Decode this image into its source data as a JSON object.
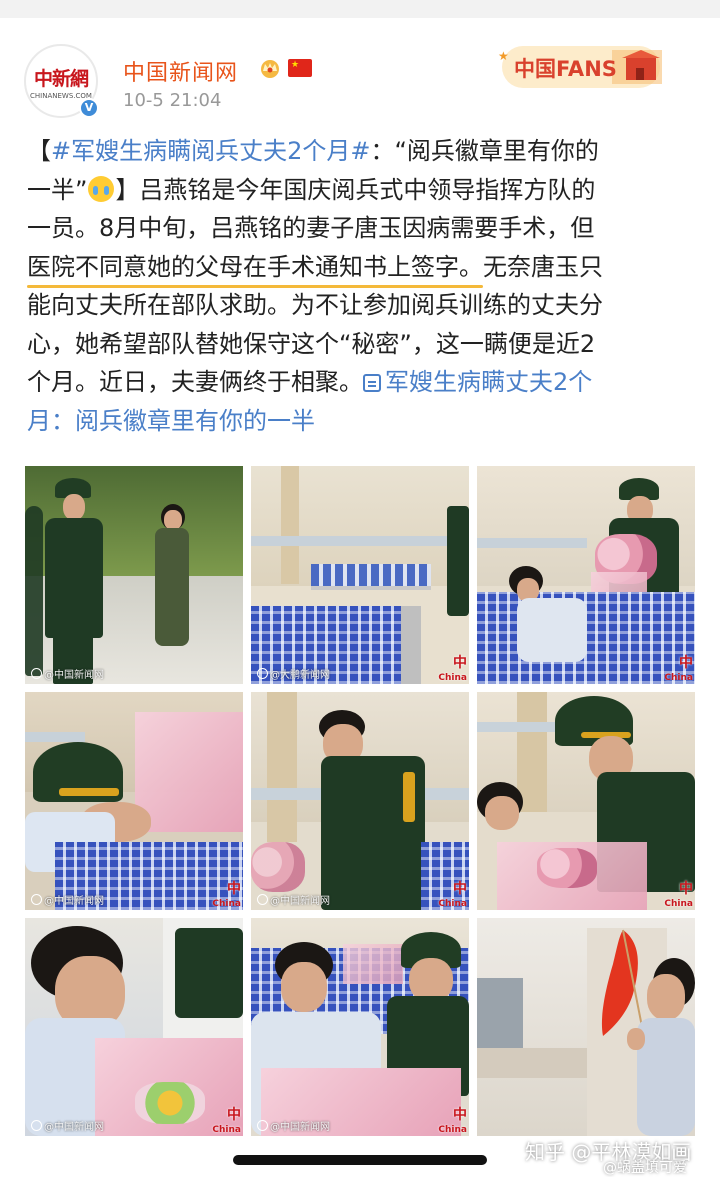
{
  "post": {
    "author": "中国新闻网",
    "avatar_logo": "中新網",
    "avatar_sub": "CHINANEWS.COM",
    "timestamp": "10-5 21:04",
    "fans_badge": "中国FANS",
    "text": {
      "l1_a": "【",
      "l1_topic": "#军嫂生病瞒阅兵丈夫2个月#",
      "l1_b": "：“阅兵徽章里有你的",
      "l2_a": "一半”",
      "l2_b": "】吕燕铭是今年国庆阅兵式中领导指挥方队的",
      "l3": "一员。8月中旬，吕燕铭的妻子唐玉因病需要手术，但",
      "l4_marked": "医院不同意她的父母在手术通知书上签字。",
      "l4_b": "无奈唐玉只",
      "l5": "能向丈夫所在部队求助。为不让参加阅兵训练的丈夫分",
      "l6": "心，她希望部队替她保守这个“秘密”，这一瞒便是近2",
      "l7_a": "个月。近日，夫妻俩终于相聚。",
      "l7_link": "军嫂生病瞒丈夫2个",
      "l8_link": "月：阅兵徽章里有你的一半"
    }
  },
  "photos": {
    "watermark": "@中国新闻网",
    "watermark_alt": "@大鹏新闻网",
    "logo": "中",
    "logo_sub": "China"
  },
  "overlay": {
    "zhihu_watermark": "知乎 @平林漠如画",
    "user_watermark": "@蜗盖填可爱"
  },
  "colors": {
    "author": "#e8541b",
    "link": "#4a7fc8",
    "underline": "#f4b93a"
  }
}
